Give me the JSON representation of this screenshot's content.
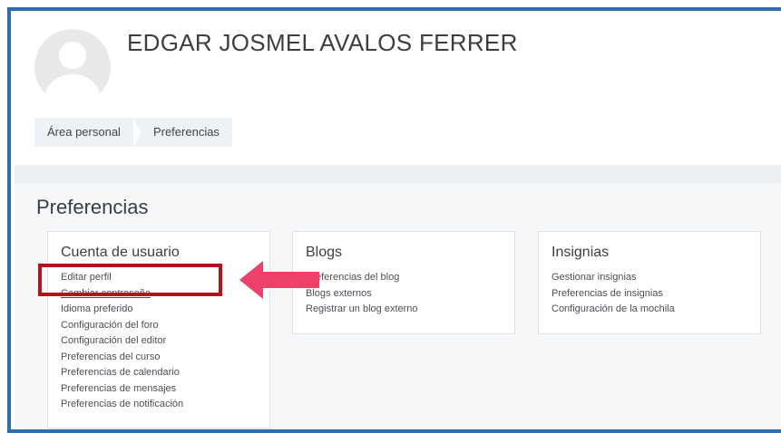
{
  "header": {
    "user_name": "EDGAR JOSMEL AVALOS FERRER",
    "breadcrumb": [
      "Área personal",
      "Preferencias"
    ]
  },
  "main": {
    "title": "Preferencias",
    "cards": [
      {
        "title": "Cuenta de usuario",
        "links": [
          "Editar perfil",
          "Cambiar contraseña",
          "Idioma preferido",
          "Configuración del foro",
          "Configuración del editor",
          "Preferencias del curso",
          "Preferencias de calendario",
          "Preferencias de mensajes",
          "Preferencias de notificación"
        ]
      },
      {
        "title": "Blogs",
        "links": [
          "Preferencias del blog",
          "Blogs externos",
          "Registrar un blog externo"
        ]
      },
      {
        "title": "Insignias",
        "links": [
          "Gestionar insignias",
          "Preferencias de insignias",
          "Configuración de la mochila"
        ]
      }
    ]
  },
  "annotation": {
    "box_color": "#b3141b",
    "arrow_color": "#ef3f6b",
    "target": "Cambiar contraseña"
  },
  "colors": {
    "frame": "#2f6db3",
    "breadcrumb_bg": "#eef1f5",
    "content_bg": "#f6f7f9"
  }
}
